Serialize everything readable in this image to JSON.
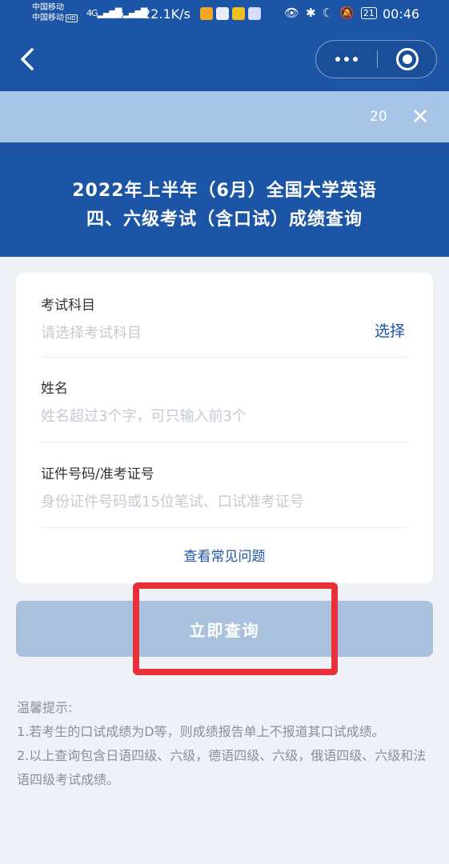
{
  "status_bar": {
    "carrier1": "中国移动",
    "carrier2": "中国移动",
    "hd_badge": "HD",
    "signal1": "4G",
    "signal2": "4G",
    "net_speed": "22.1K/s",
    "battery": "21",
    "time": "00:46",
    "icons": [
      "weibo-icon",
      "mail-icon",
      "app-icon",
      "music-icon",
      "eye-icon",
      "bluetooth-icon",
      "moon-icon",
      "mute-icon"
    ]
  },
  "nav": {
    "icons": [
      "back-arrow-icon",
      "more-dots-icon",
      "close-target-icon"
    ]
  },
  "banner": {
    "count": "20"
  },
  "header": {
    "title_line1": "2022年上半年（6月）全国大学英语",
    "title_line2": "四、六级考试（含口试）成绩查询"
  },
  "form": {
    "subject_label": "考试科目",
    "subject_placeholder": "请选择考试科目",
    "select_label": "选择",
    "name_label": "姓名",
    "name_placeholder": "姓名超过3个字，可只输入前3个",
    "id_label": "证件号码/准考证号",
    "id_placeholder": "身份证件号码或15位笔试、口试准考证号",
    "faq_link": "查看常见问题"
  },
  "query_button": "立即查询",
  "tips": {
    "title": "温馨提示:",
    "item1": "1.若考生的口试成绩为D等，则成绩报告单上不报道其口试成绩。",
    "item2": "2.以上查询包含日语四级、六级，德语四级、六级，俄语四级、六级和法语四级考试成绩。"
  },
  "colors": {
    "primary": "#1d55a6",
    "banner": "#a8c5e8",
    "button_disabled": "#a9c1dc",
    "highlight": "#e8303a"
  }
}
